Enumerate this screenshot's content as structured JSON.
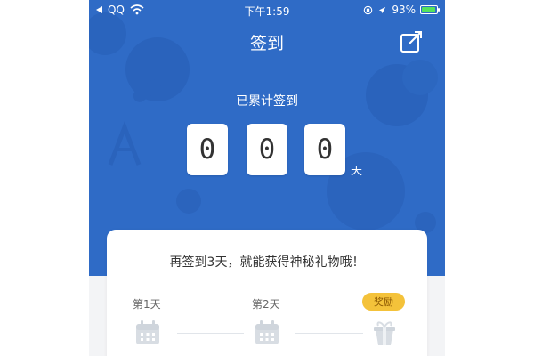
{
  "status_bar": {
    "carrier": "QQ",
    "time": "下午1:59",
    "battery": "93%",
    "battery_level": 0.93
  },
  "header": {
    "title": "签到",
    "share_icon": "share-icon"
  },
  "checkin": {
    "subtitle": "已累计签到",
    "digits": [
      "0",
      "0",
      "0"
    ],
    "unit": "天"
  },
  "card": {
    "message": "再签到3天，就能获得神秘礼物哦！",
    "days": [
      {
        "label": "第1天",
        "icon": "calendar-icon"
      },
      {
        "label": "第2天",
        "icon": "calendar-icon"
      }
    ],
    "reward": {
      "label": "奖励",
      "icon": "gift-icon"
    }
  },
  "colors": {
    "hero_blue": "#2f6bc6",
    "reward_yellow": "#f4c23a",
    "card_white": "#ffffff",
    "icon_gray": "#d8dde3"
  }
}
